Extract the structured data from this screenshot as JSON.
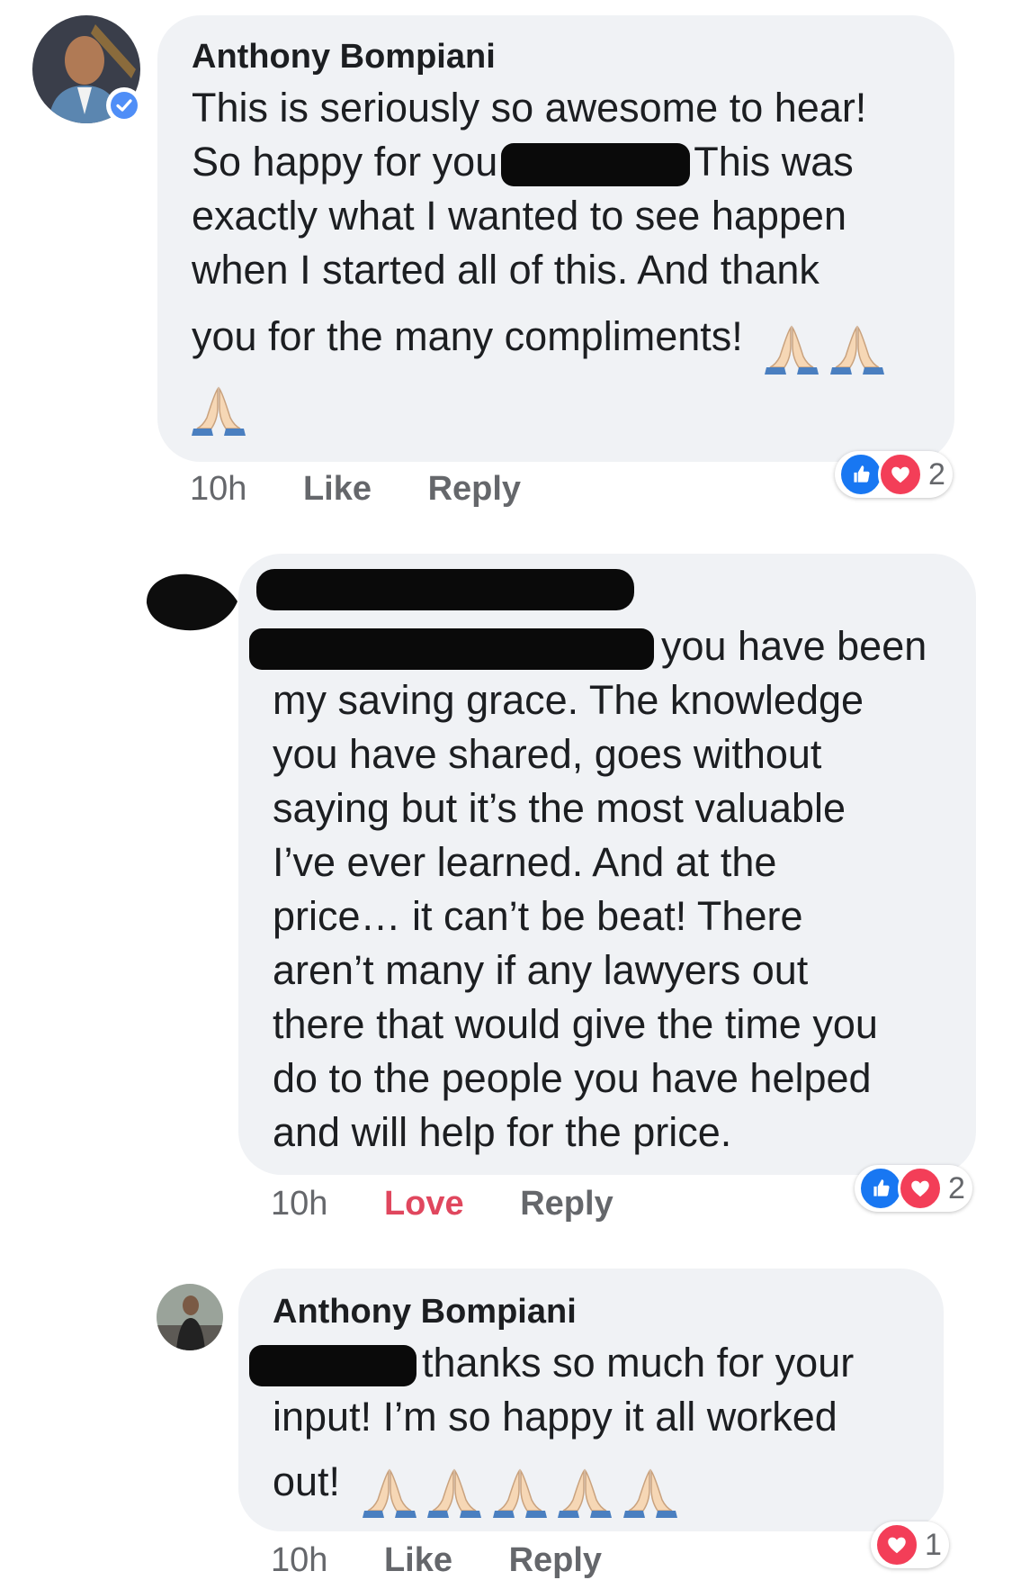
{
  "comments": [
    {
      "author": "Anthony Bompiani",
      "verified": true,
      "lines": [
        "This is seriously so awesome to hear!",
        "So happy for you",
        "This was",
        "exactly what I wanted to see happen",
        "when I started all of this. And thank",
        "you for the many compliments!"
      ],
      "emojis": [
        "folded-hands",
        "folded-hands",
        "folded-hands"
      ],
      "time": "10h",
      "action_primary": "Like",
      "action_reply": "Reply",
      "reactions": [
        "like",
        "love"
      ],
      "reaction_count": "2"
    },
    {
      "author": "",
      "author_redacted": true,
      "lines": [
        "you have been",
        "my saving grace.  The knowledge",
        "you have shared, goes without",
        "saying but it’s the most valuable",
        "I’ve ever learned.  And at the",
        "price…  it can’t be beat!  There",
        "aren’t many if any lawyers out",
        "there that would give the time you",
        "do to the people you have helped",
        "and will help for the price."
      ],
      "time": "10h",
      "action_primary": "Love",
      "action_reply": "Reply",
      "reactions": [
        "like",
        "love"
      ],
      "reaction_count": "2"
    },
    {
      "author": "Anthony Bompiani",
      "lines": [
        "thanks so much for your",
        "input! I’m so happy it all worked",
        "out!"
      ],
      "emojis": [
        "folded-hands",
        "folded-hands",
        "folded-hands",
        "folded-hands",
        "folded-hands"
      ],
      "time": "10h",
      "action_primary": "Like",
      "action_reply": "Reply",
      "reactions": [
        "love"
      ],
      "reaction_count": "1"
    }
  ],
  "colors": {
    "bubble": "#f0f2f5",
    "like_blue": "#1877f2",
    "love_red": "#f33e58",
    "love_text": "#e0475e",
    "meta_gray": "#65676b"
  }
}
